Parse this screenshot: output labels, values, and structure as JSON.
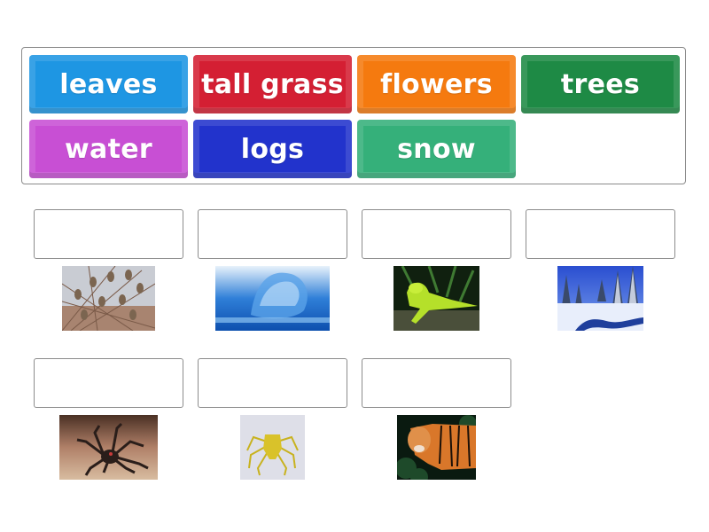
{
  "word_bank": {
    "tiles": [
      {
        "label": "leaves",
        "color": "#1e96e3"
      },
      {
        "label": "tall grass",
        "color": "#d41f33"
      },
      {
        "label": "flowers",
        "color": "#f57a0f"
      },
      {
        "label": "trees",
        "color": "#1e8a45"
      },
      {
        "label": "water",
        "color": "#c84fd4"
      },
      {
        "label": "logs",
        "color": "#2233cc"
      },
      {
        "label": "snow",
        "color": "#35b07a"
      }
    ]
  },
  "targets": [
    {
      "image": "sparrows on branches",
      "answer": ""
    },
    {
      "image": "water splash",
      "answer": ""
    },
    {
      "image": "green lizard",
      "answer": ""
    },
    {
      "image": "snowy forest stream",
      "answer": ""
    },
    {
      "image": "tarantula spider",
      "answer": ""
    },
    {
      "image": "yellow crab spider",
      "answer": ""
    },
    {
      "image": "tiger",
      "answer": ""
    }
  ]
}
